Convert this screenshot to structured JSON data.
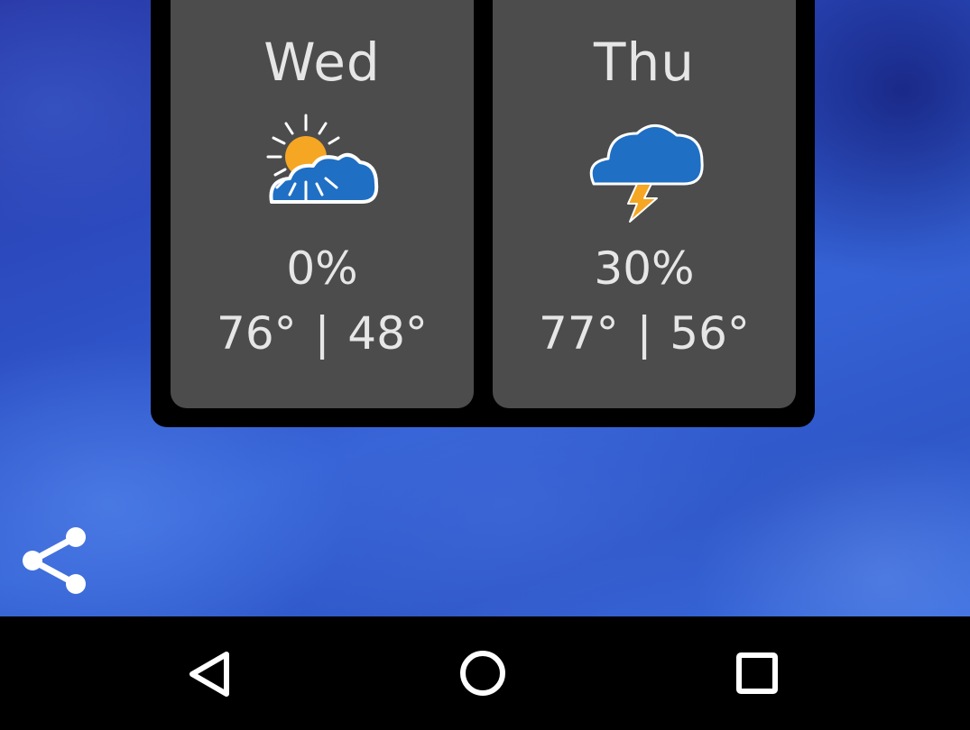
{
  "forecast": {
    "days": [
      {
        "name": "Wed",
        "icon": "partly-sunny-icon",
        "precip": "0%",
        "temps": "76° | 48°"
      },
      {
        "name": "Thu",
        "icon": "thunderstorm-icon",
        "precip": "30%",
        "temps": "77° | 56°"
      }
    ]
  },
  "colors": {
    "card_bg": "#4c4c4c",
    "panel_bg": "#000000",
    "sun": "#f5a623",
    "cloud": "#1f6fc4",
    "bolt": "#f5a623",
    "text": "#e6e6e6"
  },
  "actions": {
    "share_icon": "share-icon"
  },
  "navigation": {
    "back_icon": "back-triangle-icon",
    "home_icon": "home-circle-icon",
    "recents_icon": "recents-square-icon"
  }
}
